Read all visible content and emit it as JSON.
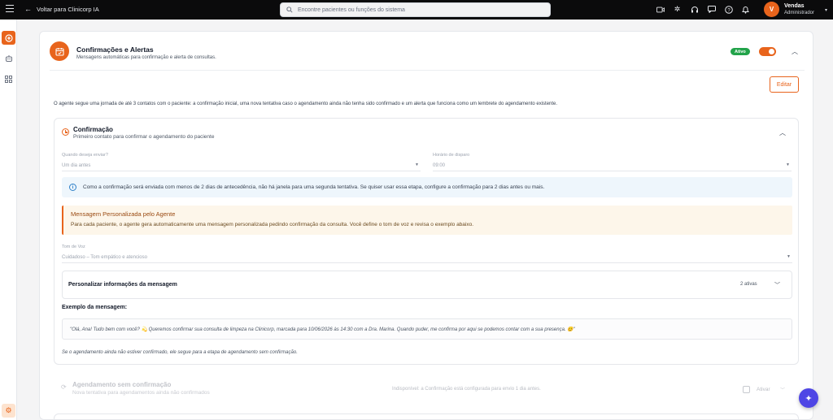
{
  "topbar": {
    "back_label": "Voltar para Clinicorp IA",
    "search_placeholder": "Encontre pacientes ou funções do sistema",
    "icons": [
      "video-icon",
      "sparkle-icon",
      "headset-icon",
      "chat-icon",
      "help-icon",
      "bell-icon"
    ],
    "user": {
      "initial": "V",
      "name": "Vendas",
      "role": "Administrador"
    }
  },
  "rail": {
    "items": [
      "plus-circle-icon",
      "robot-icon",
      "apps-icon"
    ],
    "bottom": "gear-icon"
  },
  "card": {
    "title": "Confirmações e Alertas",
    "subtitle": "Mensagens automáticas para confirmação e alerta de consultas.",
    "status_badge": "Ativo",
    "toggle_on": true,
    "edit_label": "Editar",
    "description": "O agente segue uma jornada de até 3 contatos com o paciente: a confirmação inicial, uma nova tentativa caso o agendamento ainda não tenha sido confirmado e um alerta que funciona como um lembrete do agendamento existente."
  },
  "confirmation": {
    "title": "Confirmação",
    "subtitle": "Primeiro contato para confirmar o agendamento do paciente",
    "when_label": "Quando deseja enviar?",
    "when_value": "Um dia antes",
    "time_label": "Horário de disparo",
    "time_value": "09:00",
    "info_text": "Como a confirmação será enviada com menos de 2 dias de antecedência, não há janela para uma segunda tentativa. Se quiser usar essa etapa, configure a confirmação para 2 dias antes ou mais.",
    "warning_title": "Mensagem Personalizada pelo Agente",
    "warning_text": "Para cada paciente, o agente gera automaticamente uma mensagem personalizada pedindo confirmação da consulta. Você define o tom de voz e revisa o exemplo abaixo.",
    "tone_label": "Tom de Voz",
    "tone_value": "Cuidadoso – Tom empático e atencioso",
    "personalize_title": "Personalizar informações da mensagem",
    "personalize_count": "2 ativas",
    "example_title": "Exemplo da mensagem:",
    "example_text": "\"Olá, Ana! Tudo bem com você? 💫 Queremos confirmar sua consulta de limpeza na Clinicorp, marcada para 10/06/2026 às 14:30 com a Dra. Marina. Quando puder, me confirma por aqui se podemos contar com a sua presença. 😊\"",
    "footnote": "Se o agendamento ainda não estiver confirmado, ele segue para a etapa de agendamento sem confirmação."
  },
  "no_confirmation": {
    "title": "Agendamento sem confirmação",
    "subtitle": "Nova tentativa para agendamentos ainda não confirmados",
    "note": "Indisponível: a Confirmação está configurada para envio 1 dia antes.",
    "activate_label": "Ativar"
  },
  "colors": {
    "accent": "#e8641c",
    "success": "#22a34a",
    "info": "#2f80c8",
    "fab": "#4f46e5"
  }
}
